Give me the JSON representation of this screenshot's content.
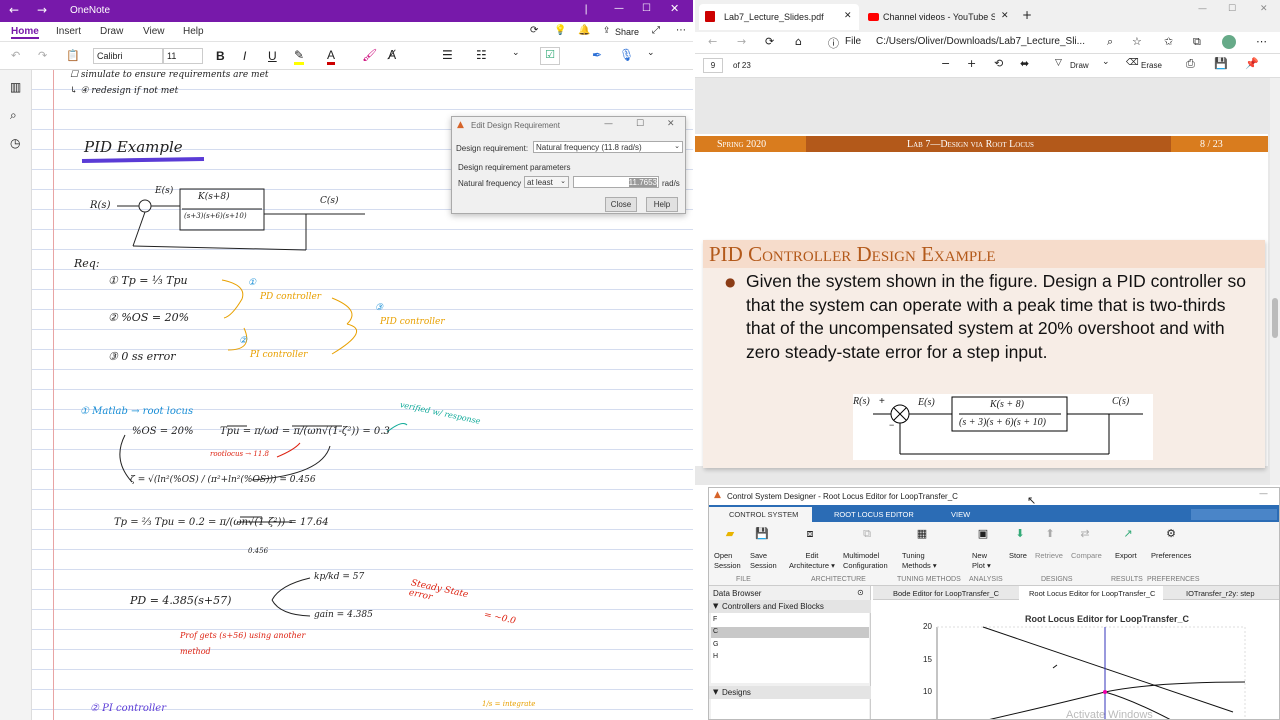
{
  "onenote": {
    "app_title": "OneNote",
    "share": "Share",
    "ribbon_tabs": [
      "Home",
      "Insert",
      "Draw",
      "View",
      "Help"
    ],
    "font_name": "Calibri",
    "font_size": "11",
    "notes": {
      "l1": "☐ simulate to ensure requirements are met",
      "l2": "↳ ④ redesign if not met",
      "pid_example": "PID Example",
      "rs": "R(s)",
      "es": "E(s)",
      "cs": "C(s)",
      "tf_num": "K(s+8)",
      "tf_den": "(s+3)(s+6)(s+10)",
      "req": "Req:",
      "req1": "① Tp = ⅓ Tpu",
      "req2": "② %OS = 20%",
      "req3": "③ 0 ss error",
      "pd_ctrl": "PD controller",
      "pi_ctrl": "PI controller",
      "pid_ctrl": "PID controller",
      "n1": "①",
      "n2": "②",
      "n3": "③",
      "matlab": "① Matlab → root locus",
      "verified": "verified w/ response",
      "os_eq": "%OS = 20%",
      "tp_eq": "Tpu = π/ωd = π/(ωn√(1-ζ²)) = 0.3",
      "rootlocus": "rootlocus → 11.8",
      "zeta_eq": "ζ = √(ln²(%OS) / (π²+ln²(%OS))) = 0.456",
      "tp2_eq": "Tp = ⅔ Tpu = 0.2 = π/(ωn√(1-ζ²)) = 17.64",
      "zeta_small": "0.456",
      "pd_eq": "PD = 4.385(s+57)",
      "kp": "kp/kd = 57",
      "gain": "gain = 4.385",
      "steady": "Steady State error",
      "to_zero": "= ~0.0",
      "prof": "Prof gets (s+56) using another method",
      "pi_heading": "② PI controller",
      "integ": "1/s = integrate"
    }
  },
  "dialog": {
    "title": "Edit Design Requirement",
    "req_label": "Design requirement:",
    "req_value": "Natural frequency (11.8 rad/s)",
    "params_label": "Design requirement parameters",
    "nf_label": "Natural frequency",
    "nf_mode": "at least",
    "nf_value": "11.7653",
    "nf_unit": "rad/s",
    "close": "Close",
    "help": "Help"
  },
  "edge": {
    "tabs": [
      {
        "label": "Lab7_Lecture_Slides.pdf"
      },
      {
        "label": "Channel videos - YouTube Studio"
      }
    ],
    "file_label": "File",
    "address": "C:/Users/Oliver/Downloads/Lab7_Lecture_Sli...",
    "page_num": "9",
    "page_total": "of 23",
    "draw": "Draw",
    "erase": "Erase"
  },
  "slide": {
    "header_left": "Spring 2020",
    "header_center": "Lab 7—Design via Root Locus",
    "header_right": "8 / 23",
    "title": "PID Controller Design Example",
    "body": "Given the system shown in the figure. Design a PID controller so that the system can operate with a peak time that is two-thirds that of the uncompensated system at 20% overshoot and with zero steady-state error for a step input.",
    "rs": "R(s)",
    "es": "E(s)",
    "cs": "C(s)",
    "plus": "+",
    "minus": "−",
    "tf_num": "K(s + 8)",
    "tf_den": "(s + 3)(s + 6)(s + 10)"
  },
  "csd": {
    "title": "Control System Designer - Root Locus Editor for LoopTransfer_C",
    "tabs": [
      "CONTROL SYSTEM",
      "ROOT LOCUS EDITOR",
      "VIEW"
    ],
    "tools": [
      {
        "label": "Open\nSession"
      },
      {
        "label": "Save\nSession"
      },
      {
        "label": "Edit\nArchitecture ▾"
      },
      {
        "label": "Multimodel\nConfiguration"
      },
      {
        "label": "Tuning\nMethods ▾"
      },
      {
        "label": "New\nPlot ▾"
      },
      {
        "label": "Store"
      },
      {
        "label": "Retrieve"
      },
      {
        "label": "Compare"
      },
      {
        "label": "Export"
      },
      {
        "label": "Preferences"
      }
    ],
    "groups": [
      "FILE",
      "ARCHITECTURE",
      "TUNING METHODS",
      "ANALYSIS",
      "DESIGNS",
      "RESULTS",
      "PREFERENCES"
    ],
    "data_browser": "Data Browser",
    "ctrl_label": "Controllers and Fixed Blocks",
    "blocks": [
      "F",
      "C",
      "G",
      "H"
    ],
    "designs": "Designs",
    "doc_tabs": [
      "Bode Editor for LoopTransfer_C",
      "Root Locus Editor for LoopTransfer_C",
      "IOTransfer_r2y: step"
    ],
    "plot_title": "Root Locus Editor for LoopTransfer_C",
    "yticks": [
      "20",
      "15",
      "10"
    ],
    "watermark": "Activate Windows"
  }
}
